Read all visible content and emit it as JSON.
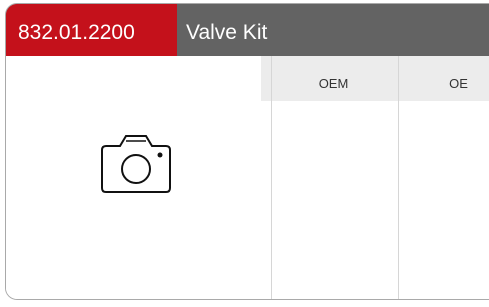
{
  "product": {
    "part_number": "832.01.2200",
    "name": "Valve Kit"
  },
  "image": {
    "icon": "camera-icon"
  },
  "table": {
    "columns": [
      "OEM",
      "OE"
    ]
  },
  "colors": {
    "brand_red": "#c4111b",
    "header_gray": "#636363",
    "column_header_bg": "#ececec"
  }
}
